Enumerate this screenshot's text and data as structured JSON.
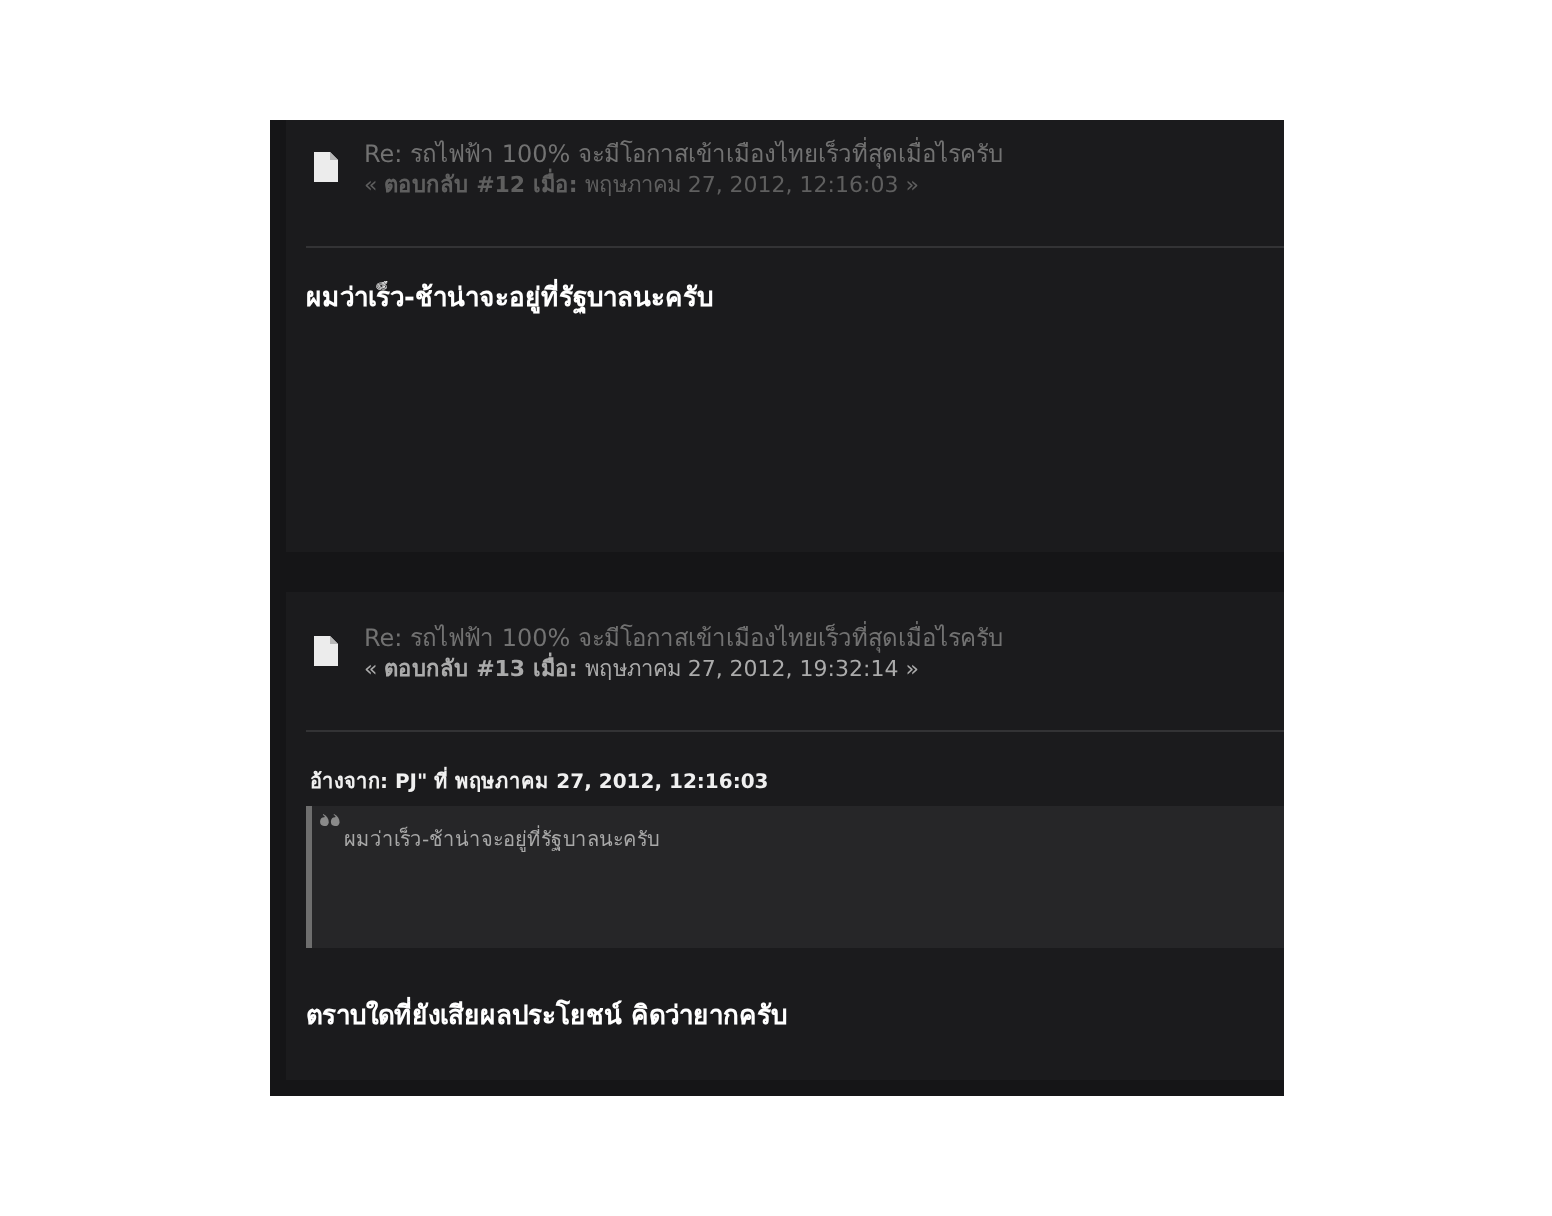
{
  "posts": [
    {
      "title": "Re: รถไฟฟ้า 100% จะมีโอกาสเข้าเมืองไทยเร็วที่สุดเมื่อไรครับ",
      "subtitle": "« **ตอบกลับ #12 เมื่อ:** พฤษภาคม 27, 2012, 12:16:03 »",
      "highlighted": false,
      "body": "ผมว่าเร็ว-ช้าน่าจะอยู่ที่รัฐบาลนะครับ"
    },
    {
      "title": "Re: รถไฟฟ้า 100% จะมีโอกาสเข้าเมืองไทยเร็วที่สุดเมื่อไรครับ",
      "subtitle": "« **ตอบกลับ #13 เมื่อ:** พฤษภาคม 27, 2012, 19:32:14 »",
      "highlighted": true,
      "quote": {
        "header": "อ้างจาก: PJ\" ที่ พฤษภาคม 27, 2012, 12:16:03",
        "text": "ผมว่าเร็ว-ช้าน่าจะอยู่ที่รัฐบาลนะครับ"
      },
      "body": "ตราบใดที่ยังเสียผลประโยชน์ คิดว่ายากครับ"
    }
  ]
}
